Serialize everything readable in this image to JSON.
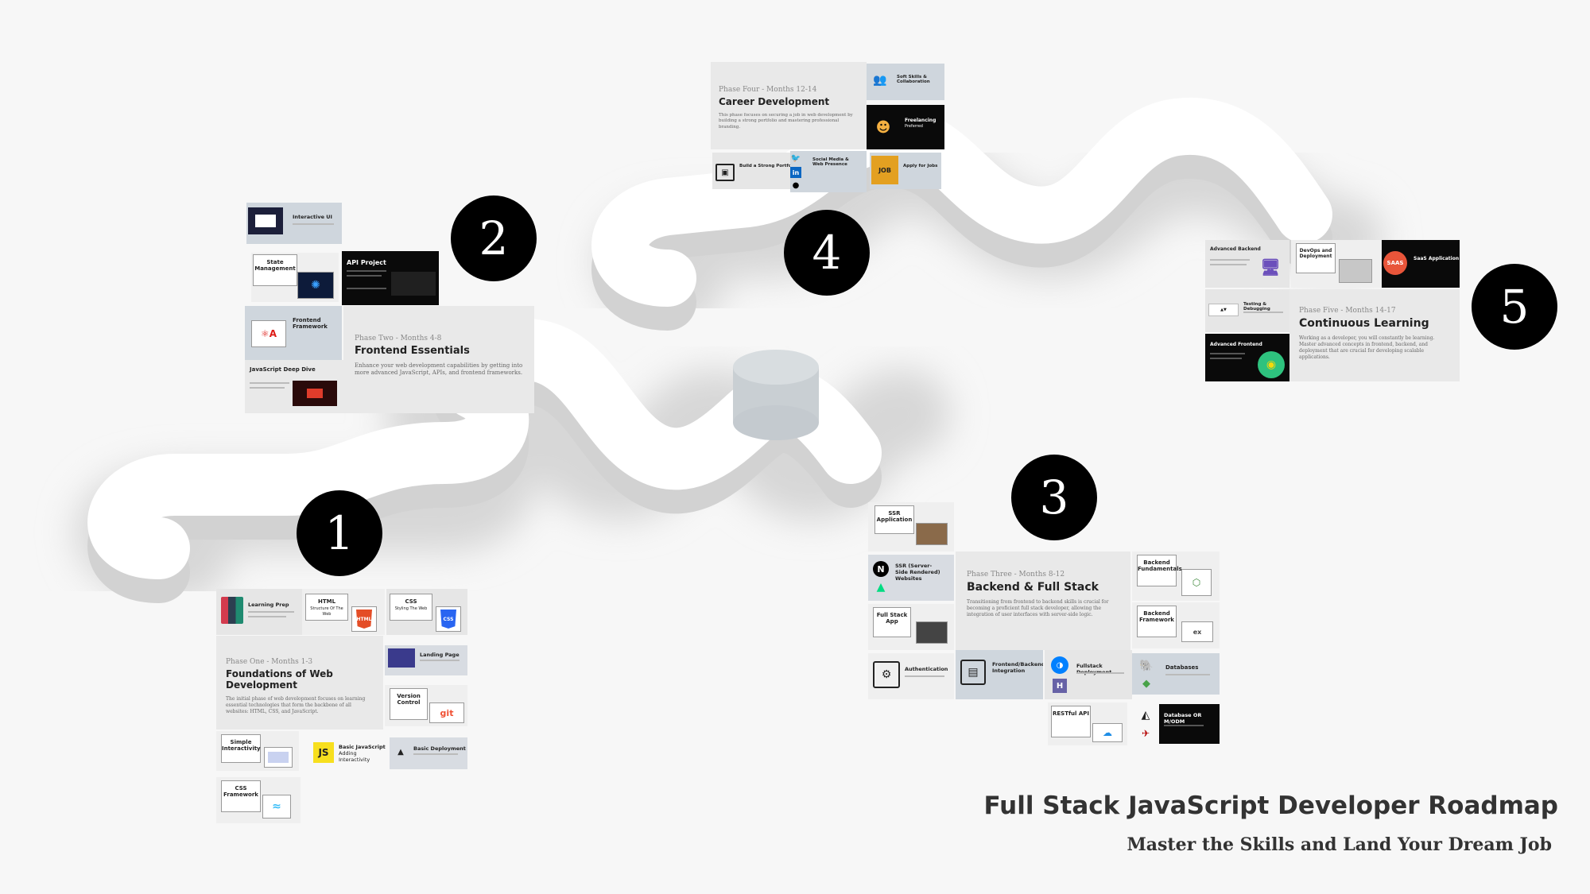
{
  "title": "Full Stack JavaScript Developer Roadmap",
  "subtitle": "Master the Skills and Land Your Dream Job",
  "colors": {
    "background": "#f7f7f7",
    "road": "#ffffff",
    "road_shadow": "#cfcfcf",
    "badge": "#000000"
  },
  "phases": [
    {
      "number": "1",
      "phase": "Phase One - Months 1-3",
      "title": "Foundations of Web Development",
      "desc": "The initial phase of web development focuses on learning essential technologies that form the backbone of all websites: HTML, CSS, and JavaScript.",
      "cards": {
        "c1": "Learning Prep",
        "c2": "HTML",
        "c2sub": "Structure Of The Web",
        "c3": "CSS",
        "c3sub": "Styling The Web",
        "c4": "Landing Page",
        "c5": "Version Control",
        "c6": "Simple Interactivity",
        "c7": "Basic JavaScript",
        "c7sub": "Adding Interactivity",
        "c8": "Basic Deployment",
        "c9": "CSS Framework"
      }
    },
    {
      "number": "2",
      "phase": "Phase Two - Months 4-8",
      "title": "Frontend Essentials",
      "desc": "Enhance your web development capabilities by getting into more advanced JavaScript, APIs, and frontend frameworks.",
      "cards": {
        "c1": "Interactive UI",
        "c2": "State Management",
        "c3": "API Project",
        "c4": "Frontend Framework",
        "c5": "JavaScript Deep Dive"
      }
    },
    {
      "number": "3",
      "phase": "Phase Three - Months 8-12",
      "title": "Backend & Full Stack",
      "desc": "Transitioning from frontend to backend skills is crucial for becoming a proficient full stack developer, allowing the integration of user interfaces with server-side logic.",
      "cards": {
        "c1": "SSR Application",
        "c2": "SSR (Server-Side Rendered) Websites",
        "c3": "Full Stack App",
        "c4": "Authentication",
        "c5": "Frontend/Backend Integration",
        "c6": "Fullstack Deployment",
        "c7": "Backend Fundamentals",
        "c8": "Backend Framework",
        "c9": "Databases",
        "c10": "RESTful API",
        "c11": "Database OR M/ODM"
      }
    },
    {
      "number": "4",
      "phase": "Phase Four - Months 12-14",
      "title": "Career Development",
      "desc": "This phase focuses on securing a job in web development by building a strong portfolio and mastering professional branding.",
      "cards": {
        "c1": "Soft Skills & Collaboration",
        "c2": "Freelancing",
        "c2sub": "Preferred",
        "c3": "Build a Strong Portfolio",
        "c4": "Social Media & Web Presence",
        "c5": "Apply for Jobs"
      }
    },
    {
      "number": "5",
      "phase": "Phase Five - Months 14-17",
      "title": "Continuous Learning",
      "desc": "Working as a developer, you will constantly be learning. Master advanced concepts in frontend, backend, and deployment that are crucial for developing scalable applications.",
      "cards": {
        "c1": "Advanced Backend",
        "c2": "DevOps and Deployment",
        "c3": "SaaS Application",
        "c4": "Testing & Debugging",
        "c5": "Advanced Frontend"
      }
    }
  ],
  "icons": {
    "html": "HTML",
    "css": "CSS",
    "js": "JS",
    "git": "git",
    "saas": "SAAS",
    "job": "JOB"
  }
}
